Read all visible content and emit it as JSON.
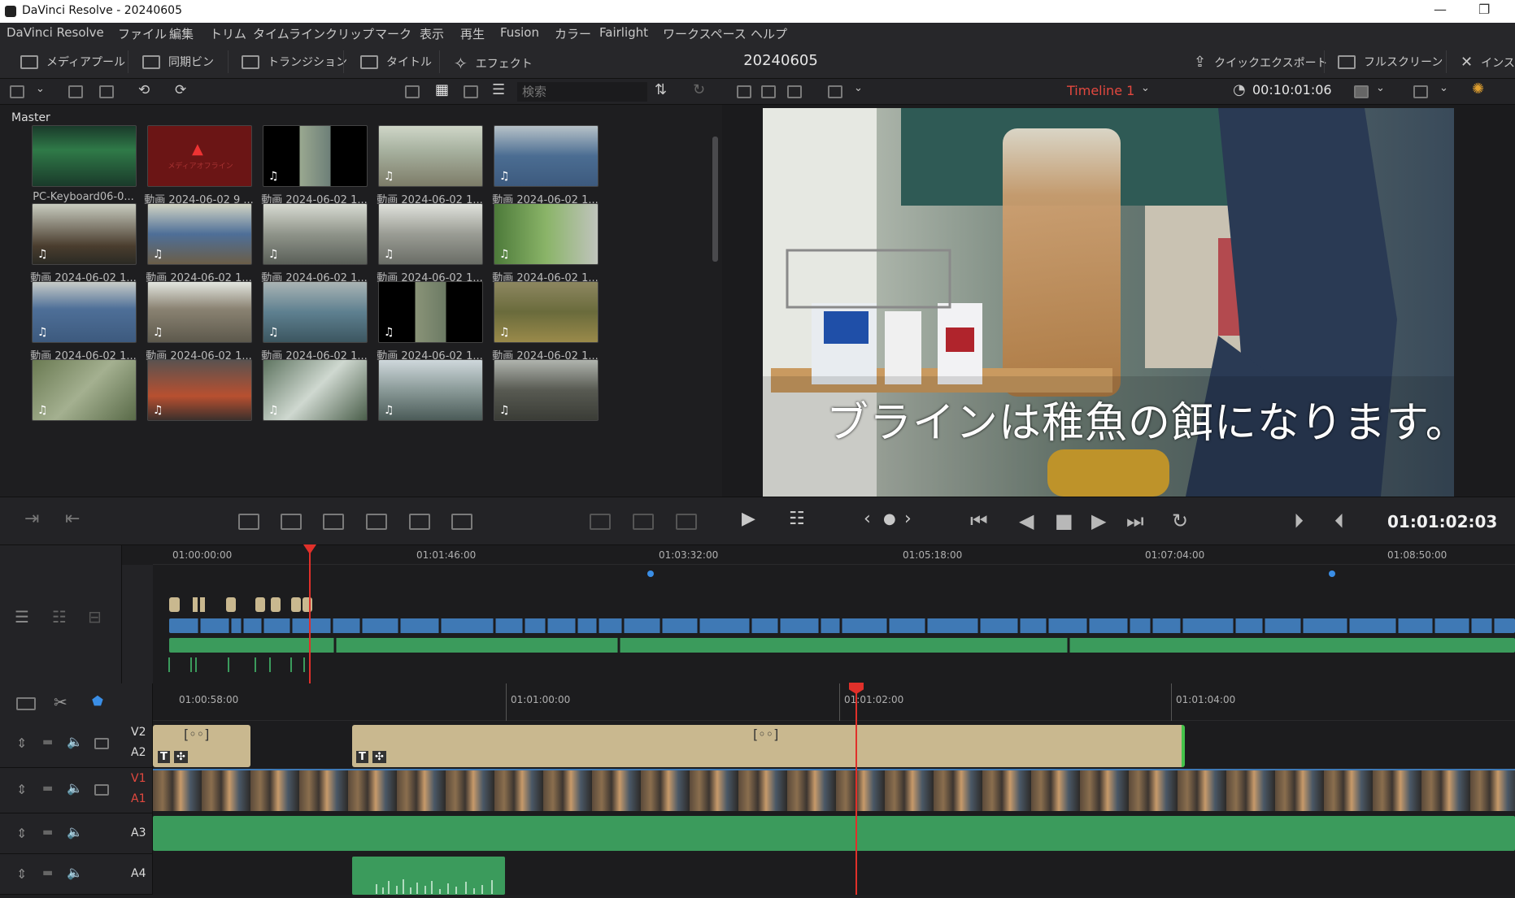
{
  "window": {
    "title": "DaVinci Resolve - 20240605"
  },
  "menu": [
    "DaVinci Resolve",
    "ファイル",
    "編集",
    "トリム",
    "タイムライン",
    "クリップ",
    "マーク",
    "表示",
    "再生",
    "Fusion",
    "カラー",
    "Fairlight",
    "ワークスペース",
    "ヘルプ"
  ],
  "toolbar": {
    "media_pool": "メディアプール",
    "sync_bin": "同期ビン",
    "transitions": "トランジション",
    "titles": "タイトル",
    "effects": "エフェクト",
    "project": "20240605",
    "quick_export": "クイックエクスポート",
    "fullscreen": "フルスクリーン",
    "inspector": "インス"
  },
  "mediapool": {
    "search_placeholder": "検索",
    "bin": "Master",
    "offline_label": "メディアオフライン",
    "clips": [
      "PC-Keyboard06-0...",
      "動画 2024-06-02 9 ...",
      "動画 2024-06-02 1...",
      "動画 2024-06-02 1...",
      "動画 2024-06-02 1...",
      "動画 2024-06-02 1...",
      "動画 2024-06-02 1...",
      "動画 2024-06-02 1...",
      "動画 2024-06-02 1...",
      "動画 2024-06-02 1...",
      "動画 2024-06-02 1...",
      "動画 2024-06-02 1...",
      "動画 2024-06-02 1...",
      "動画 2024-06-02 1...",
      "動画 2024-06-02 1...",
      "",
      "",
      "",
      "",
      ""
    ]
  },
  "viewer": {
    "timeline_name": "Timeline 1",
    "timecode_top": "00:10:01:06",
    "timecode": "01:01:02:03",
    "subtitle": "ブラインは稚魚の餌になります。"
  },
  "minitimeline": {
    "ruler": [
      "01:00:00:00",
      "01:01:46:00",
      "01:03:32:00",
      "01:05:18:00",
      "01:07:04:00",
      "01:08:50:00"
    ],
    "tracks": [
      "V2",
      "V1",
      "A3",
      "A4"
    ]
  },
  "maintimeline": {
    "ruler": [
      "01:00:58:00",
      "01:01:00:00",
      "01:01:02:00",
      "01:01:04:00"
    ],
    "tracks": [
      [
        "V2",
        "A2"
      ],
      [
        "V1",
        "A1"
      ],
      [
        "A3"
      ],
      [
        "A4"
      ]
    ]
  },
  "colors": {
    "accent": "#e2483f",
    "audio": "#3b9b5c",
    "video": "#3f79b5",
    "title": "#c9b88f"
  }
}
